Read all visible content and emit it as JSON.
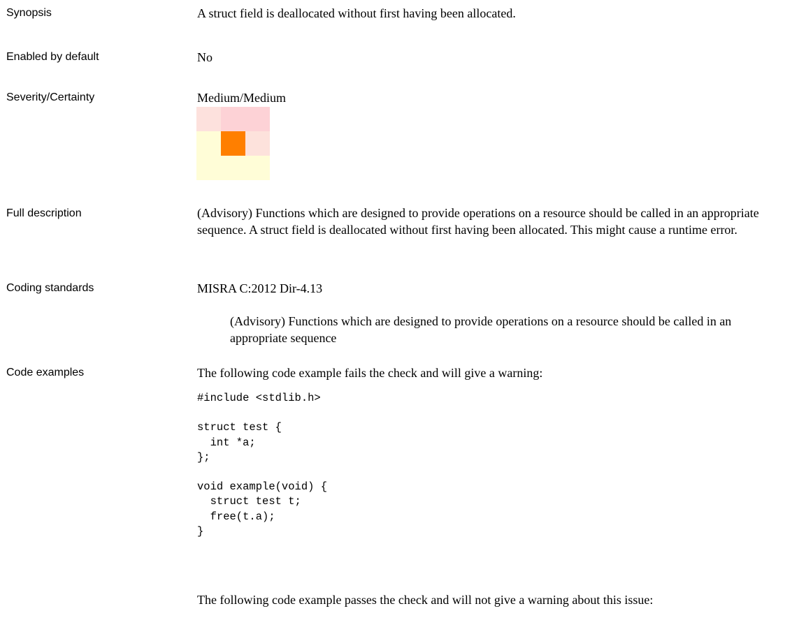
{
  "synopsis": {
    "label": "Synopsis",
    "text": "A struct field is deallocated without first having been allocated."
  },
  "enabled": {
    "label": "Enabled by default",
    "text": "No"
  },
  "severity": {
    "label": "Severity/Certainty",
    "text": "Medium/Medium",
    "matrix_colors": [
      [
        "#fde1dd",
        "#fdd2d6",
        "#fdd2d6"
      ],
      [
        "#fffdd7",
        "#ff7f00",
        "#fde2dc"
      ],
      [
        "#fffdd7",
        "#fffdd7",
        "#fffdd7"
      ]
    ],
    "highlighted_cell": {
      "row": 2,
      "col": 2
    }
  },
  "full_description": {
    "label": "Full description",
    "text": " (Advisory) Functions which are designed to provide operations on a resource should be called in an appropriate sequence.  A struct field is deallocated without first having been allocated. This might cause a runtime error."
  },
  "coding_standards": {
    "label": "Coding standards",
    "standard": "MISRA C:2012 Dir-4.13",
    "standard_text": "(Advisory) Functions which are designed to provide operations on a resource should be called in an appropriate sequence"
  },
  "code_examples": {
    "label": "Code examples",
    "fail_intro": "The following code example fails the check and will give a warning:",
    "fail_code": "#include <stdlib.h>\n\nstruct test {\n  int *a;\n};\n\nvoid example(void) {\n  struct test t;\n  free(t.a);\n}",
    "pass_intro": "The following code example passes the check and will not give a warning about this issue:"
  }
}
